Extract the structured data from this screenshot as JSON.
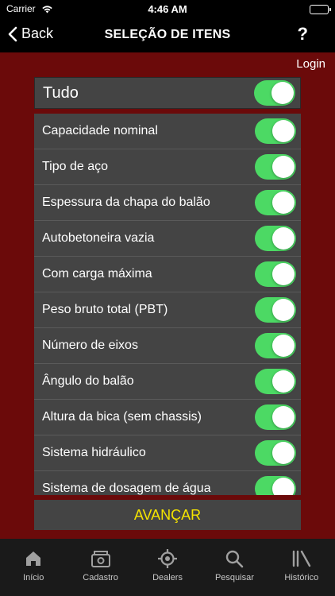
{
  "status": {
    "carrier": "Carrier",
    "time": "4:46 AM"
  },
  "nav": {
    "back_label": "Back",
    "title": "SELEÇÃO DE ITENS",
    "help_label": "?"
  },
  "login_label": "Login",
  "tudo": {
    "label": "Tudo",
    "on": true
  },
  "items": [
    {
      "label": "Capacidade nominal",
      "on": true
    },
    {
      "label": "Tipo de aço",
      "on": true
    },
    {
      "label": "Espessura da chapa do balão",
      "on": true
    },
    {
      "label": "Autobetoneira vazia",
      "on": true
    },
    {
      "label": "Com carga máxima",
      "on": true
    },
    {
      "label": "Peso bruto total (PBT)",
      "on": true
    },
    {
      "label": "Número de eixos",
      "on": true
    },
    {
      "label": "Ângulo do balão",
      "on": true
    },
    {
      "label": "Altura da bica (sem chassis)",
      "on": true
    },
    {
      "label": "Sistema hidráulico",
      "on": true
    },
    {
      "label": "Sistema de dosagem de água",
      "on": true
    }
  ],
  "advance_label": "AVANÇAR",
  "tabs": [
    {
      "label": "Início",
      "icon": "home-icon"
    },
    {
      "label": "Cadastro",
      "icon": "cadastro-icon"
    },
    {
      "label": "Dealers",
      "icon": "location-icon"
    },
    {
      "label": "Pesquisar",
      "icon": "search-icon"
    },
    {
      "label": "Histórico",
      "icon": "history-icon"
    }
  ],
  "colors": {
    "content_bg": "#6b0a0a",
    "row_bg": "#444444",
    "toggle_on": "#4cd964",
    "advance_text": "#f5e400",
    "tab_bar_bg": "#1a1a1a"
  }
}
